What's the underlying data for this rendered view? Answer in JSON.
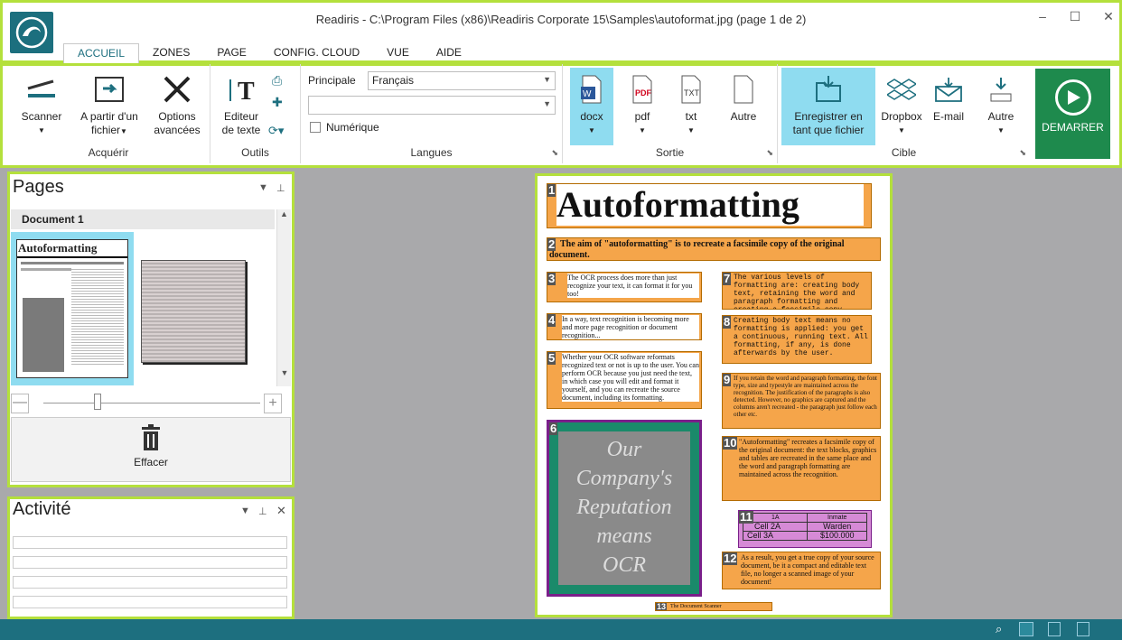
{
  "window": {
    "title": "Readiris - C:\\Program Files (x86)\\Readiris Corporate 15\\Samples\\autoformat.jpg (page 1 de 2)",
    "min": "–",
    "max": "☐",
    "close": "✕"
  },
  "tabs": [
    "ACCUEIL",
    "ZONES",
    "PAGE",
    "CONFIG. CLOUD",
    "VUE",
    "AIDE"
  ],
  "acquerir": {
    "label": "Acquérir",
    "scanner": "Scanner",
    "fromfile1": "A partir d'un",
    "fromfile2": "fichier",
    "options1": "Options",
    "options2": "avancées"
  },
  "outils": {
    "label": "Outils",
    "editor1": "Editeur",
    "editor2": "de texte"
  },
  "langues": {
    "label": "Langues",
    "principale": "Principale",
    "primary_value": "Français",
    "secondary_value": "",
    "numerique": "Numérique"
  },
  "sortie": {
    "label": "Sortie",
    "docx": "docx",
    "pdf": "pdf",
    "txt": "txt",
    "autre": "Autre"
  },
  "cible": {
    "label": "Cible",
    "save1": "Enregistrer en",
    "save2": "tant que fichier",
    "dropbox": "Dropbox",
    "email": "E-mail",
    "autre": "Autre"
  },
  "demarrer": "DEMARRER",
  "pages": {
    "title": "Pages",
    "document": "Document 1",
    "effacer": "Effacer",
    "thumb_title": "Autoformatting"
  },
  "activite": {
    "title": "Activité"
  },
  "doc": {
    "title": "Autoformatting",
    "z2": "The aim of \"autoformatting\" is to recreate a facsimile copy of the original document.",
    "z3": "The OCR process does more than just recognize your text, it can format it for you too!",
    "z4": "In a way, text recognition is becoming more and more page recognition or document recognition...",
    "z5": "Whether your OCR software reformats recognized text or not is up to the user. You can perform OCR because you just need the text, in which case you will edit and format it yourself, and you can recreate the source document, including its formatting.",
    "z6_lines": [
      "Our",
      "Company's",
      "Reputation",
      "means",
      "OCR"
    ],
    "z7": "The various levels of formatting are: creating body text, retaining the word and paragraph formatting and creating a facsimile copy.",
    "z8": "Creating body text means no formatting is applied: you get a continuous, running text. All formatting, if any, is done afterwards by the user.",
    "z9": "If you retain the word and paragraph formatting, the font type, size and typestyle are maintained across the recognition. The justification of the paragraphs is also detected. However, no graphics are captured and the columns aren't recreated - the paragraph just follow each other etc.",
    "z10": "\"Autoformatting\" recreates a facsimile copy of the original document: the text blocks, graphics and tables are recreated in the same place and the word and paragraph formatting are maintained across the recognition.",
    "z11_head": [
      "1A",
      "Inmate"
    ],
    "z11_rows": [
      [
        "Cell 2A",
        "Warden"
      ],
      [
        "Cell 3A",
        "$100.000"
      ]
    ],
    "z12": "As a result, you get a true copy of your source document, be it a compact and editable text file, no longer a scanned image of your document!",
    "z13": "The Document Scanner"
  },
  "zone_numbers": [
    "1",
    "2",
    "3",
    "4",
    "5",
    "6",
    "7",
    "8",
    "9",
    "10",
    "11",
    "12",
    "13"
  ]
}
